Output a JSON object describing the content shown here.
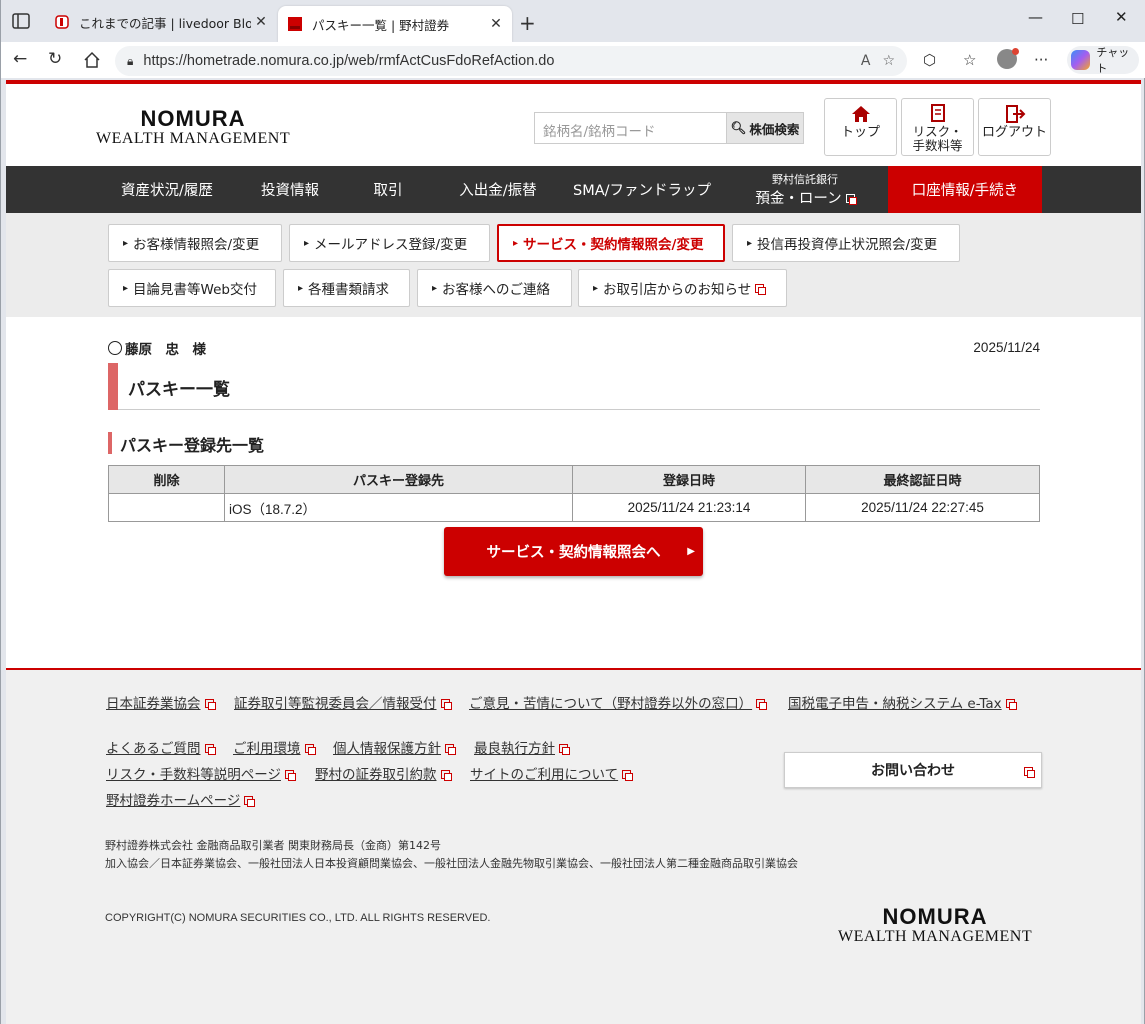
{
  "browser": {
    "tabs": [
      {
        "title": "これまでの記事 | livedoor Blog",
        "active": false
      },
      {
        "title": "パスキー一覧 | 野村證券",
        "active": true
      }
    ],
    "url": "https://hometrade.nomura.co.jp/web/rmfActCusFdoRefAction.do",
    "copilot_label": "チャット"
  },
  "header": {
    "logo_top": "NOMURA",
    "logo_bottom": "WEALTH MANAGEMENT",
    "search_placeholder": "銘柄名/銘柄コード",
    "search_button": "株価検索",
    "buttons": [
      {
        "label": "トップ",
        "icon": "home-icon"
      },
      {
        "label": "リスク・\n手数料等",
        "icon": "document-icon"
      },
      {
        "label": "ログアウト",
        "icon": "logout-icon"
      }
    ]
  },
  "gnav": [
    {
      "label": "資産状況/履歴"
    },
    {
      "label": "投資情報"
    },
    {
      "label": "取引"
    },
    {
      "label": "入出金/振替"
    },
    {
      "label": "SMA/ファンドラップ"
    },
    {
      "sub": "野村信託銀行",
      "label": "預金・ローン"
    },
    {
      "label": "口座情報/手続き"
    }
  ],
  "subnav": [
    {
      "label": "お客様情報照会/変更"
    },
    {
      "label": "メールアドレス登録/変更"
    },
    {
      "label": "サービス・契約情報照会/変更"
    },
    {
      "label": "投信再投資停止状況照会/変更"
    },
    {
      "label": "目論見書等Web交付"
    },
    {
      "label": "各種書類請求"
    },
    {
      "label": "お客様へのご連絡"
    },
    {
      "label": "お取引店からのお知らせ"
    }
  ],
  "content": {
    "user_name": "藤原　忠　様",
    "date": "2025/11/24",
    "page_title": "パスキー一覧",
    "section_title": "パスキー登録先一覧",
    "table": {
      "headers": [
        "削除",
        "パスキー登録先",
        "登録日時",
        "最終認証日時"
      ],
      "rows": [
        [
          "",
          "iOS（18.7.2）",
          "2025/11/24 21:23:14",
          "2025/11/24 22:27:45"
        ]
      ]
    },
    "action_button": "サービス・契約情報照会へ"
  },
  "footer": {
    "links_row1": [
      "日本証券業協会",
      "証券取引等監視委員会／情報受付",
      "ご意見・苦情について（野村證券以外の窓口）",
      "国税電子申告・納税システム e-Tax"
    ],
    "links_row2": [
      "よくあるご質問",
      "ご利用環境",
      "個人情報保護方針",
      "最良執行方針"
    ],
    "links_row3": [
      "リスク・手数料等説明ページ",
      "野村の証券取引約款",
      "サイトのご利用について"
    ],
    "links_row4": [
      "野村證券ホームページ"
    ],
    "contact_button": "お問い合わせ",
    "info_line1": "野村證券株式会社 金融商品取引業者 関東財務局長（金商）第142号",
    "info_line2": "加入協会／日本証券業協会、一般社団法人日本投資顧問業協会、一般社団法人金融先物取引業協会、一般社団法人第二種金融商品取引業協会",
    "copyright": "COPYRIGHT(C) NOMURA SECURITIES CO., LTD. ALL RIGHTS RESERVED."
  },
  "colors": {
    "brand_red": "#cc0000",
    "nav_dark": "#333333",
    "accent_pink": "#dd6666"
  }
}
